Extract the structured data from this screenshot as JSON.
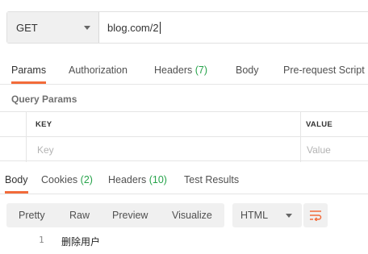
{
  "request": {
    "method": "GET",
    "url": "blog.com/2"
  },
  "request_tabs": [
    {
      "label": "Params",
      "count": ""
    },
    {
      "label": "Authorization",
      "count": ""
    },
    {
      "label": "Headers",
      "count": "(7)"
    },
    {
      "label": "Body",
      "count": ""
    },
    {
      "label": "Pre-request Script",
      "count": ""
    }
  ],
  "query_params": {
    "title": "Query Params",
    "columns": {
      "key": "KEY",
      "value": "VALUE"
    },
    "placeholders": {
      "key": "Key",
      "value": "Value"
    }
  },
  "response_tabs": [
    {
      "label": "Body",
      "count": ""
    },
    {
      "label": "Cookies",
      "count": "(2)"
    },
    {
      "label": "Headers",
      "count": "(10)"
    },
    {
      "label": "Test Results",
      "count": ""
    }
  ],
  "response_toolbar": {
    "modes": [
      "Pretty",
      "Raw",
      "Preview",
      "Visualize"
    ],
    "format": "HTML",
    "wrap_icon": "wrap-lines-icon"
  },
  "response_body": {
    "line_number": "1",
    "text": "删除用户"
  },
  "colors": {
    "accent": "#f26b3a",
    "count": "#26a34a"
  }
}
